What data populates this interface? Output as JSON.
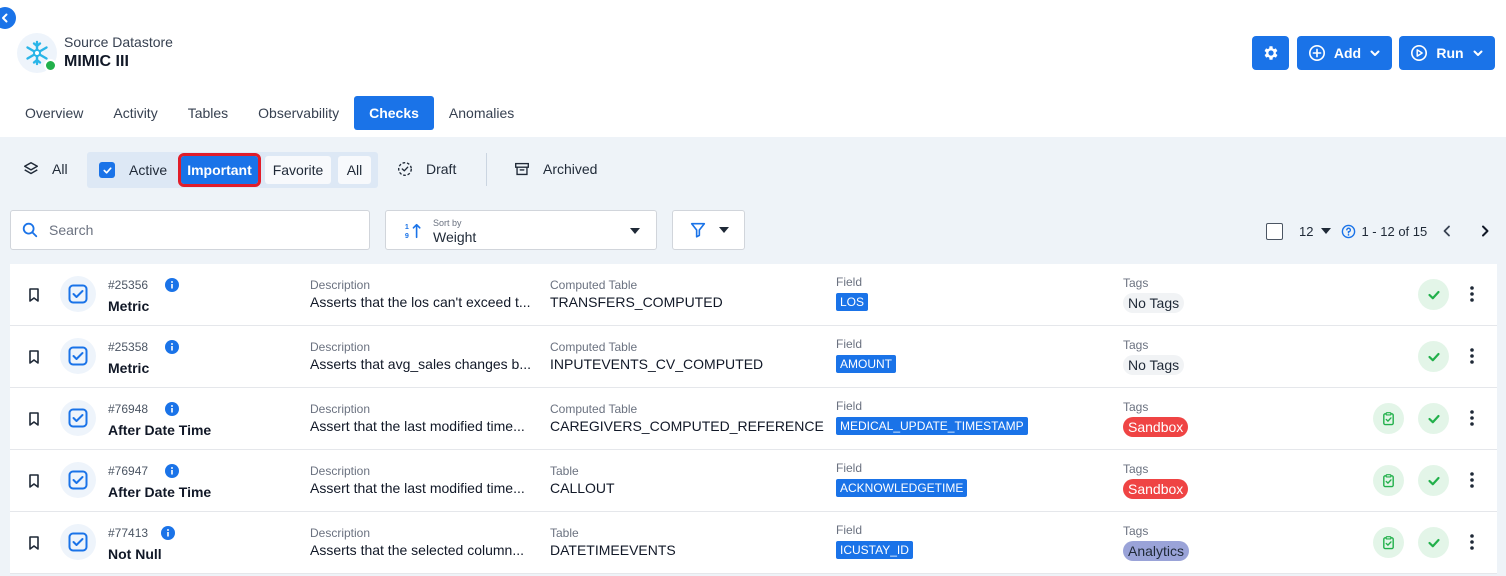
{
  "datastore": {
    "label": "Source Datastore",
    "name": "MIMIC III",
    "status_color": "#22b04b"
  },
  "header_buttons": {
    "settings_icon": "gear-icon",
    "add_label": "Add",
    "run_label": "Run"
  },
  "tabs": [
    {
      "label": "Overview"
    },
    {
      "label": "Activity"
    },
    {
      "label": "Tables"
    },
    {
      "label": "Observability"
    },
    {
      "label": "Checks",
      "active": true
    },
    {
      "label": "Anomalies"
    }
  ],
  "filters": {
    "all_label": "All",
    "active_label": "Active",
    "active_checked": true,
    "important_label": "Important",
    "favorite_label": "Favorite",
    "active_all_label": "All",
    "draft_label": "Draft",
    "archived_label": "Archived"
  },
  "search": {
    "placeholder": "Search"
  },
  "sort": {
    "label": "Sort by",
    "value": "Weight"
  },
  "pagination": {
    "page_size": "12",
    "range": "1 - 12 of 15"
  },
  "checks": [
    {
      "id": "#25356",
      "type": "Metric",
      "desc_label": "Description",
      "description": "Asserts that the los can't exceed t...",
      "table_label": "Computed Table",
      "table": "TRANSFERS_COMPUTED",
      "field_label": "Field",
      "field": "LOS",
      "tags_label": "Tags",
      "tag": "No Tags",
      "tag_style": "none",
      "has_clipboard": false
    },
    {
      "id": "#25358",
      "type": "Metric",
      "desc_label": "Description",
      "description": "Asserts that avg_sales changes b...",
      "table_label": "Computed Table",
      "table": "INPUTEVENTS_CV_COMPUTED",
      "field_label": "Field",
      "field": "AMOUNT",
      "tags_label": "Tags",
      "tag": "No Tags",
      "tag_style": "none",
      "has_clipboard": false
    },
    {
      "id": "#76948",
      "type": "After Date Time",
      "desc_label": "Description",
      "description": "Assert that the last modified time...",
      "table_label": "Computed Table",
      "table": "CAREGIVERS_COMPUTED_REFERENCE",
      "field_label": "Field",
      "field": "MEDICAL_UPDATE_TIMESTAMP",
      "tags_label": "Tags",
      "tag": "Sandbox",
      "tag_style": "sandbox",
      "has_clipboard": true
    },
    {
      "id": "#76947",
      "type": "After Date Time",
      "desc_label": "Description",
      "description": "Assert that the last modified time...",
      "table_label": "Table",
      "table": "CALLOUT",
      "field_label": "Field",
      "field": "ACKNOWLEDGETIME",
      "tags_label": "Tags",
      "tag": "Sandbox",
      "tag_style": "sandbox",
      "has_clipboard": true
    },
    {
      "id": "#77413",
      "type": "Not Null",
      "desc_label": "Description",
      "description": "Asserts that the selected column...",
      "table_label": "Table",
      "table": "DATETIMEEVENTS",
      "field_label": "Field",
      "field": "ICUSTAY_ID",
      "tags_label": "Tags",
      "tag": "Analytics",
      "tag_style": "analytics",
      "has_clipboard": true
    }
  ],
  "colors": {
    "accent": "#1a73e8",
    "highlight_outline": "#e11d2a",
    "success_bg": "#e3f5e8",
    "success": "#22b04b"
  }
}
